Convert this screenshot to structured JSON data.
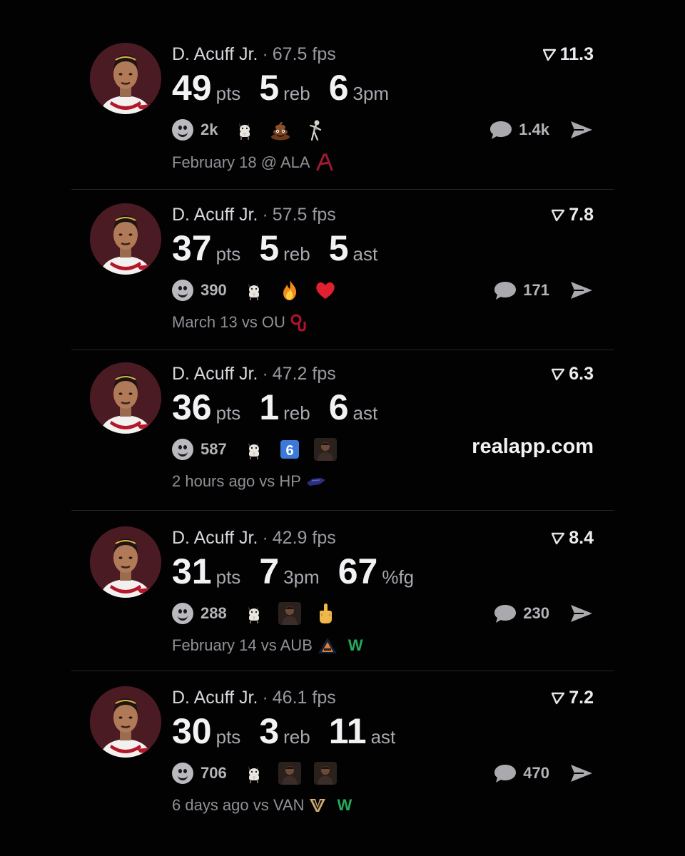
{
  "cards": [
    {
      "player": "D. Acuff Jr.",
      "fps": "67.5 fps",
      "score": "11.3",
      "stats": [
        {
          "value": "49",
          "unit": "pts"
        },
        {
          "value": "5",
          "unit": "reb"
        },
        {
          "value": "6",
          "unit": "3pm"
        }
      ],
      "reaction_count": "2k",
      "emojis": [
        "goat-emoji",
        "poop-emoji",
        "skeleton-emoji"
      ],
      "comment_count": "1.4k",
      "date": "February 18 @ ALA",
      "opponent_logo": "alabama-logo",
      "result": ""
    },
    {
      "player": "D. Acuff Jr.",
      "fps": "57.5 fps",
      "score": "7.8",
      "stats": [
        {
          "value": "37",
          "unit": "pts"
        },
        {
          "value": "5",
          "unit": "reb"
        },
        {
          "value": "5",
          "unit": "ast"
        }
      ],
      "reaction_count": "390",
      "emojis": [
        "goat-emoji",
        "fire-emoji",
        "heart-emoji"
      ],
      "comment_count": "171",
      "date": "March 13 vs OU",
      "opponent_logo": "oklahoma-logo",
      "result": ""
    },
    {
      "player": "D. Acuff Jr.",
      "fps": "47.2 fps",
      "score": "6.3",
      "stats": [
        {
          "value": "36",
          "unit": "pts"
        },
        {
          "value": "1",
          "unit": "reb"
        },
        {
          "value": "6",
          "unit": "ast"
        }
      ],
      "reaction_count": "587",
      "emojis": [
        "goat-emoji",
        "six-keycap-emoji",
        "player-photo-emoji"
      ],
      "website": "realapp.com",
      "date": "2 hours ago vs HP",
      "opponent_logo": "high-point-logo",
      "result": ""
    },
    {
      "player": "D. Acuff Jr.",
      "fps": "42.9 fps",
      "score": "8.4",
      "stats": [
        {
          "value": "31",
          "unit": "pts"
        },
        {
          "value": "7",
          "unit": "3pm"
        },
        {
          "value": "67",
          "unit": "%fg"
        }
      ],
      "reaction_count": "288",
      "emojis": [
        "goat-emoji",
        "player-photo-emoji",
        "middle-finger-emoji"
      ],
      "comment_count": "230",
      "date": "February 14 vs AUB",
      "opponent_logo": "auburn-logo",
      "result": "W"
    },
    {
      "player": "D. Acuff Jr.",
      "fps": "46.1 fps",
      "score": "7.2",
      "stats": [
        {
          "value": "30",
          "unit": "pts"
        },
        {
          "value": "3",
          "unit": "reb"
        },
        {
          "value": "11",
          "unit": "ast"
        }
      ],
      "reaction_count": "706",
      "emojis": [
        "goat-emoji",
        "player-photo-emoji",
        "player-photo-emoji"
      ],
      "comment_count": "470",
      "date": "6 days ago vs VAN",
      "opponent_logo": "vanderbilt-logo",
      "result": "W"
    }
  ],
  "colors": {
    "background": "#020203",
    "win": "#25a95a",
    "avatar_bg": "#4a1b23"
  }
}
